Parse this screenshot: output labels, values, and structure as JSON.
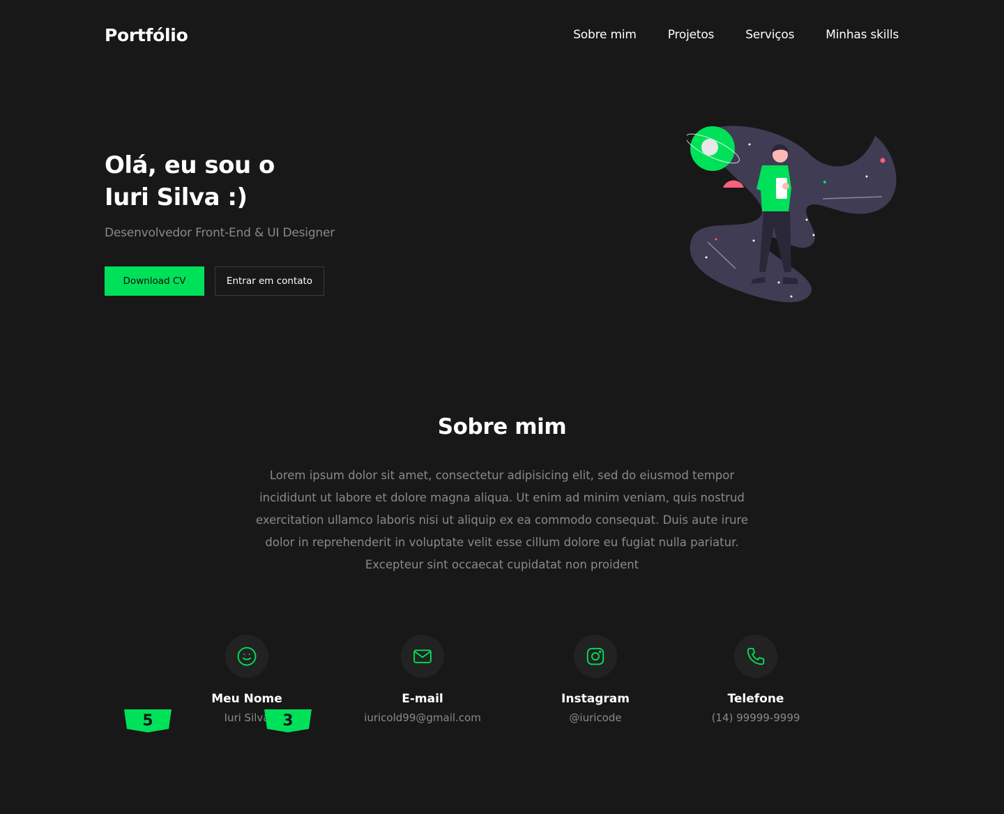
{
  "header": {
    "logo": "Portfólio",
    "nav": [
      "Sobre mim",
      "Projetos",
      "Serviços",
      "Minhas skills"
    ]
  },
  "hero": {
    "title_line1": "Olá, eu sou o",
    "title_line2": "Iuri Silva :)",
    "subtitle": "Desenvolvedor Front-End & UI Designer",
    "primary_button": "Download CV",
    "secondary_button": "Entrar em contato"
  },
  "about": {
    "title": "Sobre mim",
    "text": "Lorem ipsum dolor sit amet, consectetur adipisicing elit, sed do eiusmod tempor incididunt ut labore et dolore magna aliqua. Ut enim ad minim veniam, quis nostrud exercitation ullamco laboris nisi ut aliquip ex ea commodo consequat. Duis aute irure dolor in reprehenderit in voluptate velit esse cillum dolore eu fugiat nulla pariatur. Excepteur sint occaecat cupidatat non proident"
  },
  "info": [
    {
      "icon": "smile-icon",
      "label": "Meu Nome",
      "value": "Iuri Silva"
    },
    {
      "icon": "mail-icon",
      "label": "E-mail",
      "value": "iuricold99@gmail.com"
    },
    {
      "icon": "instagram-icon",
      "label": "Instagram",
      "value": "@iuricode"
    },
    {
      "icon": "phone-icon",
      "label": "Telefone",
      "value": "(14) 99999-9999"
    }
  ],
  "badges": [
    {
      "icon": "html5-icon",
      "glyph": "5"
    },
    {
      "icon": "css3-icon",
      "glyph": "3"
    }
  ],
  "colors": {
    "background": "#181818",
    "accent": "#00e15a",
    "muted_text": "#8a8a8a",
    "icon_circle": "#222222"
  }
}
